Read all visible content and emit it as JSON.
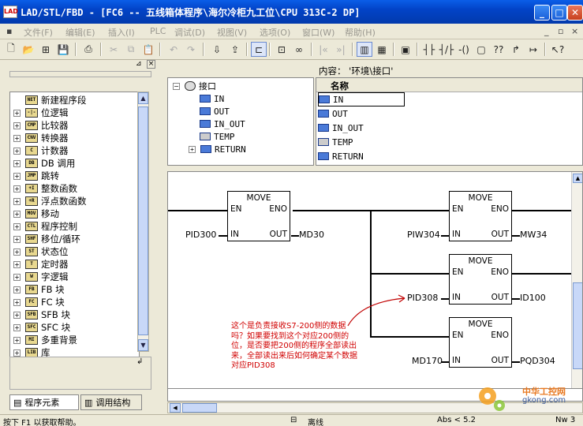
{
  "window": {
    "title": "LAD/STL/FBD  - [FC6 -- 五线箱体程序\\海尔冷柜九工位\\CPU 313C-2 DP]",
    "app_icon": "LAD"
  },
  "menu": [
    "文件(F)",
    "编辑(E)",
    "插入(I)",
    "PLC",
    "调试(D)",
    "视图(V)",
    "选项(O)",
    "窗口(W)",
    "帮助(H)"
  ],
  "tree_items": [
    {
      "label": "新建程序段",
      "icon": "NET"
    },
    {
      "label": "位逻辑",
      "icon": "-|-"
    },
    {
      "label": "比较器",
      "icon": "CMP"
    },
    {
      "label": "转换器",
      "icon": "CNV"
    },
    {
      "label": "计数器",
      "icon": "C"
    },
    {
      "label": "DB 调用",
      "icon": "DB"
    },
    {
      "label": "跳转",
      "icon": "JMP"
    },
    {
      "label": "整数函数",
      "icon": "+I"
    },
    {
      "label": "浮点数函数",
      "icon": "+R"
    },
    {
      "label": "移动",
      "icon": "MOV"
    },
    {
      "label": "程序控制",
      "icon": "CTL"
    },
    {
      "label": "移位/循环",
      "icon": "SHF"
    },
    {
      "label": "状态位",
      "icon": "ST"
    },
    {
      "label": "定时器",
      "icon": "T"
    },
    {
      "label": "字逻辑",
      "icon": "W"
    },
    {
      "label": "FB 块",
      "icon": "FB"
    },
    {
      "label": "FC 块",
      "icon": "FC"
    },
    {
      "label": "SFB 块",
      "icon": "SFB"
    },
    {
      "label": "SFC 块",
      "icon": "SFC"
    },
    {
      "label": "多重背景",
      "icon": "MI"
    },
    {
      "label": "库",
      "icon": "LIB"
    }
  ],
  "left_tabs": [
    "程序元素",
    "调用结构"
  ],
  "interface": {
    "root": "接口",
    "items": [
      "IN",
      "OUT",
      "IN_OUT",
      "TEMP",
      "RETURN"
    ]
  },
  "content": {
    "label": "内容：  '环境\\接口'",
    "header": "名称",
    "rows": [
      "IN",
      "OUT",
      "IN_OUT",
      "TEMP",
      "RETURN"
    ]
  },
  "ladder": {
    "blocks": [
      {
        "title": "MOVE",
        "en": "EN",
        "eno": "ENO",
        "in": "IN",
        "out": "OUT",
        "in_operand": "PID300",
        "out_operand": "MD30"
      },
      {
        "title": "MOVE",
        "en": "EN",
        "eno": "ENO",
        "in": "IN",
        "out": "OUT",
        "in_operand": "PIW304",
        "out_operand": "MW34"
      },
      {
        "title": "MOVE",
        "en": "EN",
        "eno": "ENO",
        "in": "IN",
        "out": "OUT",
        "in_operand": "PID308",
        "out_operand": "ID100"
      },
      {
        "title": "MOVE",
        "en": "EN",
        "eno": "ENO",
        "in": "IN",
        "out": "OUT",
        "in_operand": "MD170",
        "out_operand": "PQD304"
      }
    ],
    "note": "这个是负责接收S7-200侧的数据吗？如果要找到这个对应200侧的位，是否要把200侧的程序全部读出来，全部读出来后如何确定某个数据对应PID308"
  },
  "status": {
    "help": "按下 F1 以获取帮助。",
    "mode": "离线",
    "abs": "Abs < 5.2",
    "nw": "Nw 3"
  },
  "watermark": {
    "cn": "中华工控网",
    "url": "gkong.com"
  },
  "colors": {
    "title_bar": "#0a5ee8",
    "note_text": "#d00000",
    "arrow": "#c00000"
  }
}
